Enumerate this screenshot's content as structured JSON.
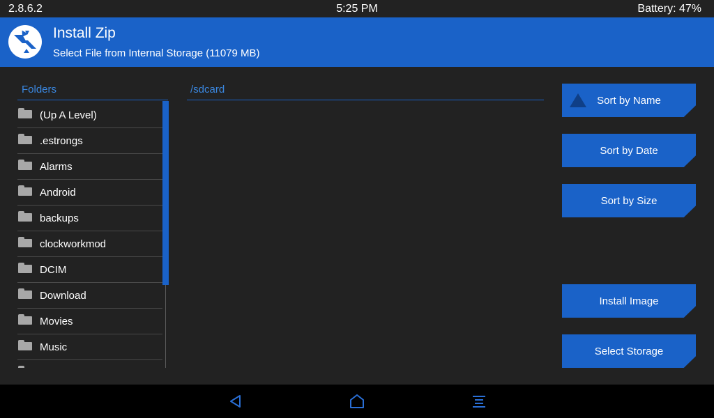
{
  "status_bar": {
    "version": "2.8.6.2",
    "time": "5:25 PM",
    "battery": "Battery: 47%"
  },
  "header": {
    "logo_icon": "twrp-logo-icon",
    "title": "Install Zip",
    "subtitle": "Select File from Internal Storage (11079 MB)"
  },
  "folders": {
    "label": "Folders",
    "items": [
      {
        "name": "(Up A Level)",
        "icon": "folder-icon"
      },
      {
        "name": ".estrongs",
        "icon": "folder-icon"
      },
      {
        "name": "Alarms",
        "icon": "folder-icon"
      },
      {
        "name": "Android",
        "icon": "folder-icon"
      },
      {
        "name": "backups",
        "icon": "folder-icon"
      },
      {
        "name": "clockworkmod",
        "icon": "folder-icon"
      },
      {
        "name": "DCIM",
        "icon": "folder-icon"
      },
      {
        "name": "Download",
        "icon": "folder-icon"
      },
      {
        "name": "Movies",
        "icon": "folder-icon"
      },
      {
        "name": "Music",
        "icon": "folder-icon"
      },
      {
        "name": "",
        "icon": "folder-icon"
      }
    ]
  },
  "files": {
    "path": "/sdcard"
  },
  "buttons": {
    "sort_name": "Sort by Name",
    "sort_date": "Sort by Date",
    "sort_size": "Sort by Size",
    "install_image": "Install Image",
    "select_storage": "Select Storage"
  },
  "nav": {
    "back_icon": "back-triangle-icon",
    "home_icon": "home-icon",
    "menu_icon": "menu-icon"
  },
  "colors": {
    "accent": "#1a62c8",
    "accent_text": "#3a87e0",
    "background": "#222222",
    "nav_background": "#000000"
  }
}
